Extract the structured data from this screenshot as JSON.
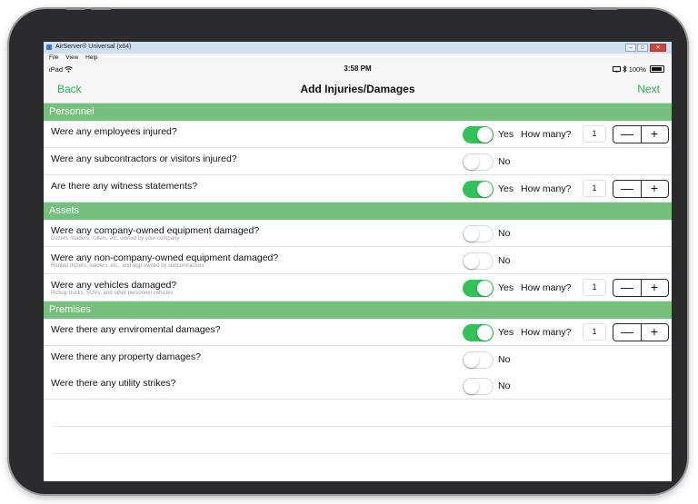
{
  "window": {
    "title": "AirServer® Universal (x64)",
    "menu": [
      "File",
      "View",
      "Help"
    ],
    "controls": {
      "minimize": "–",
      "maximize": "□",
      "close": "✕"
    }
  },
  "status_bar": {
    "carrier": "iPad",
    "time": "3:58 PM",
    "battery": "100%"
  },
  "nav": {
    "back": "Back",
    "title": "Add Injuries/Damages",
    "next": "Next"
  },
  "colors": {
    "accent": "#2fae56",
    "section_header": "#74c07c",
    "toggle_on": "#33c15a"
  },
  "sections": [
    {
      "title": "Personnel",
      "rows": [
        {
          "question": "Were any employees injured?",
          "subtitle": "",
          "on": true,
          "state": "Yes",
          "how_many": "How many?",
          "count": "1"
        },
        {
          "question": "Were any subcontractors or visitors injured?",
          "subtitle": "",
          "on": false,
          "state": "No"
        },
        {
          "question": "Are there any witness statements?",
          "subtitle": "",
          "on": true,
          "state": "Yes",
          "how_many": "How many?",
          "count": "1"
        }
      ]
    },
    {
      "title": "Assets",
      "rows": [
        {
          "question": "Were any company-owned equipment damaged?",
          "subtitle": "Dozers, loaders, rollers, etc. owned by your company",
          "on": false,
          "state": "No"
        },
        {
          "question": "Were any non-company-owned equipment damaged?",
          "subtitle": "Rented dozers, loaders, etc., and eqp owned by subcontractors",
          "on": false,
          "state": "No"
        },
        {
          "question": "Were any vehicles damaged?",
          "subtitle": "Pickup trucks, SUVs, and other personnel vehicles",
          "on": true,
          "state": "Yes",
          "how_many": "How many?",
          "count": "1"
        }
      ]
    },
    {
      "title": "Premises",
      "rows": [
        {
          "question": "Were there any enviromental damages?",
          "subtitle": "",
          "on": true,
          "state": "Yes",
          "how_many": "How many?",
          "count": "1"
        },
        {
          "question": "Were there any property damages?",
          "subtitle": "",
          "on": false,
          "state": "No"
        },
        {
          "question": "Were there any utility strikes?",
          "subtitle": "",
          "on": false,
          "state": "No"
        }
      ]
    }
  ],
  "stepper": {
    "minus": "—",
    "plus": "+"
  }
}
